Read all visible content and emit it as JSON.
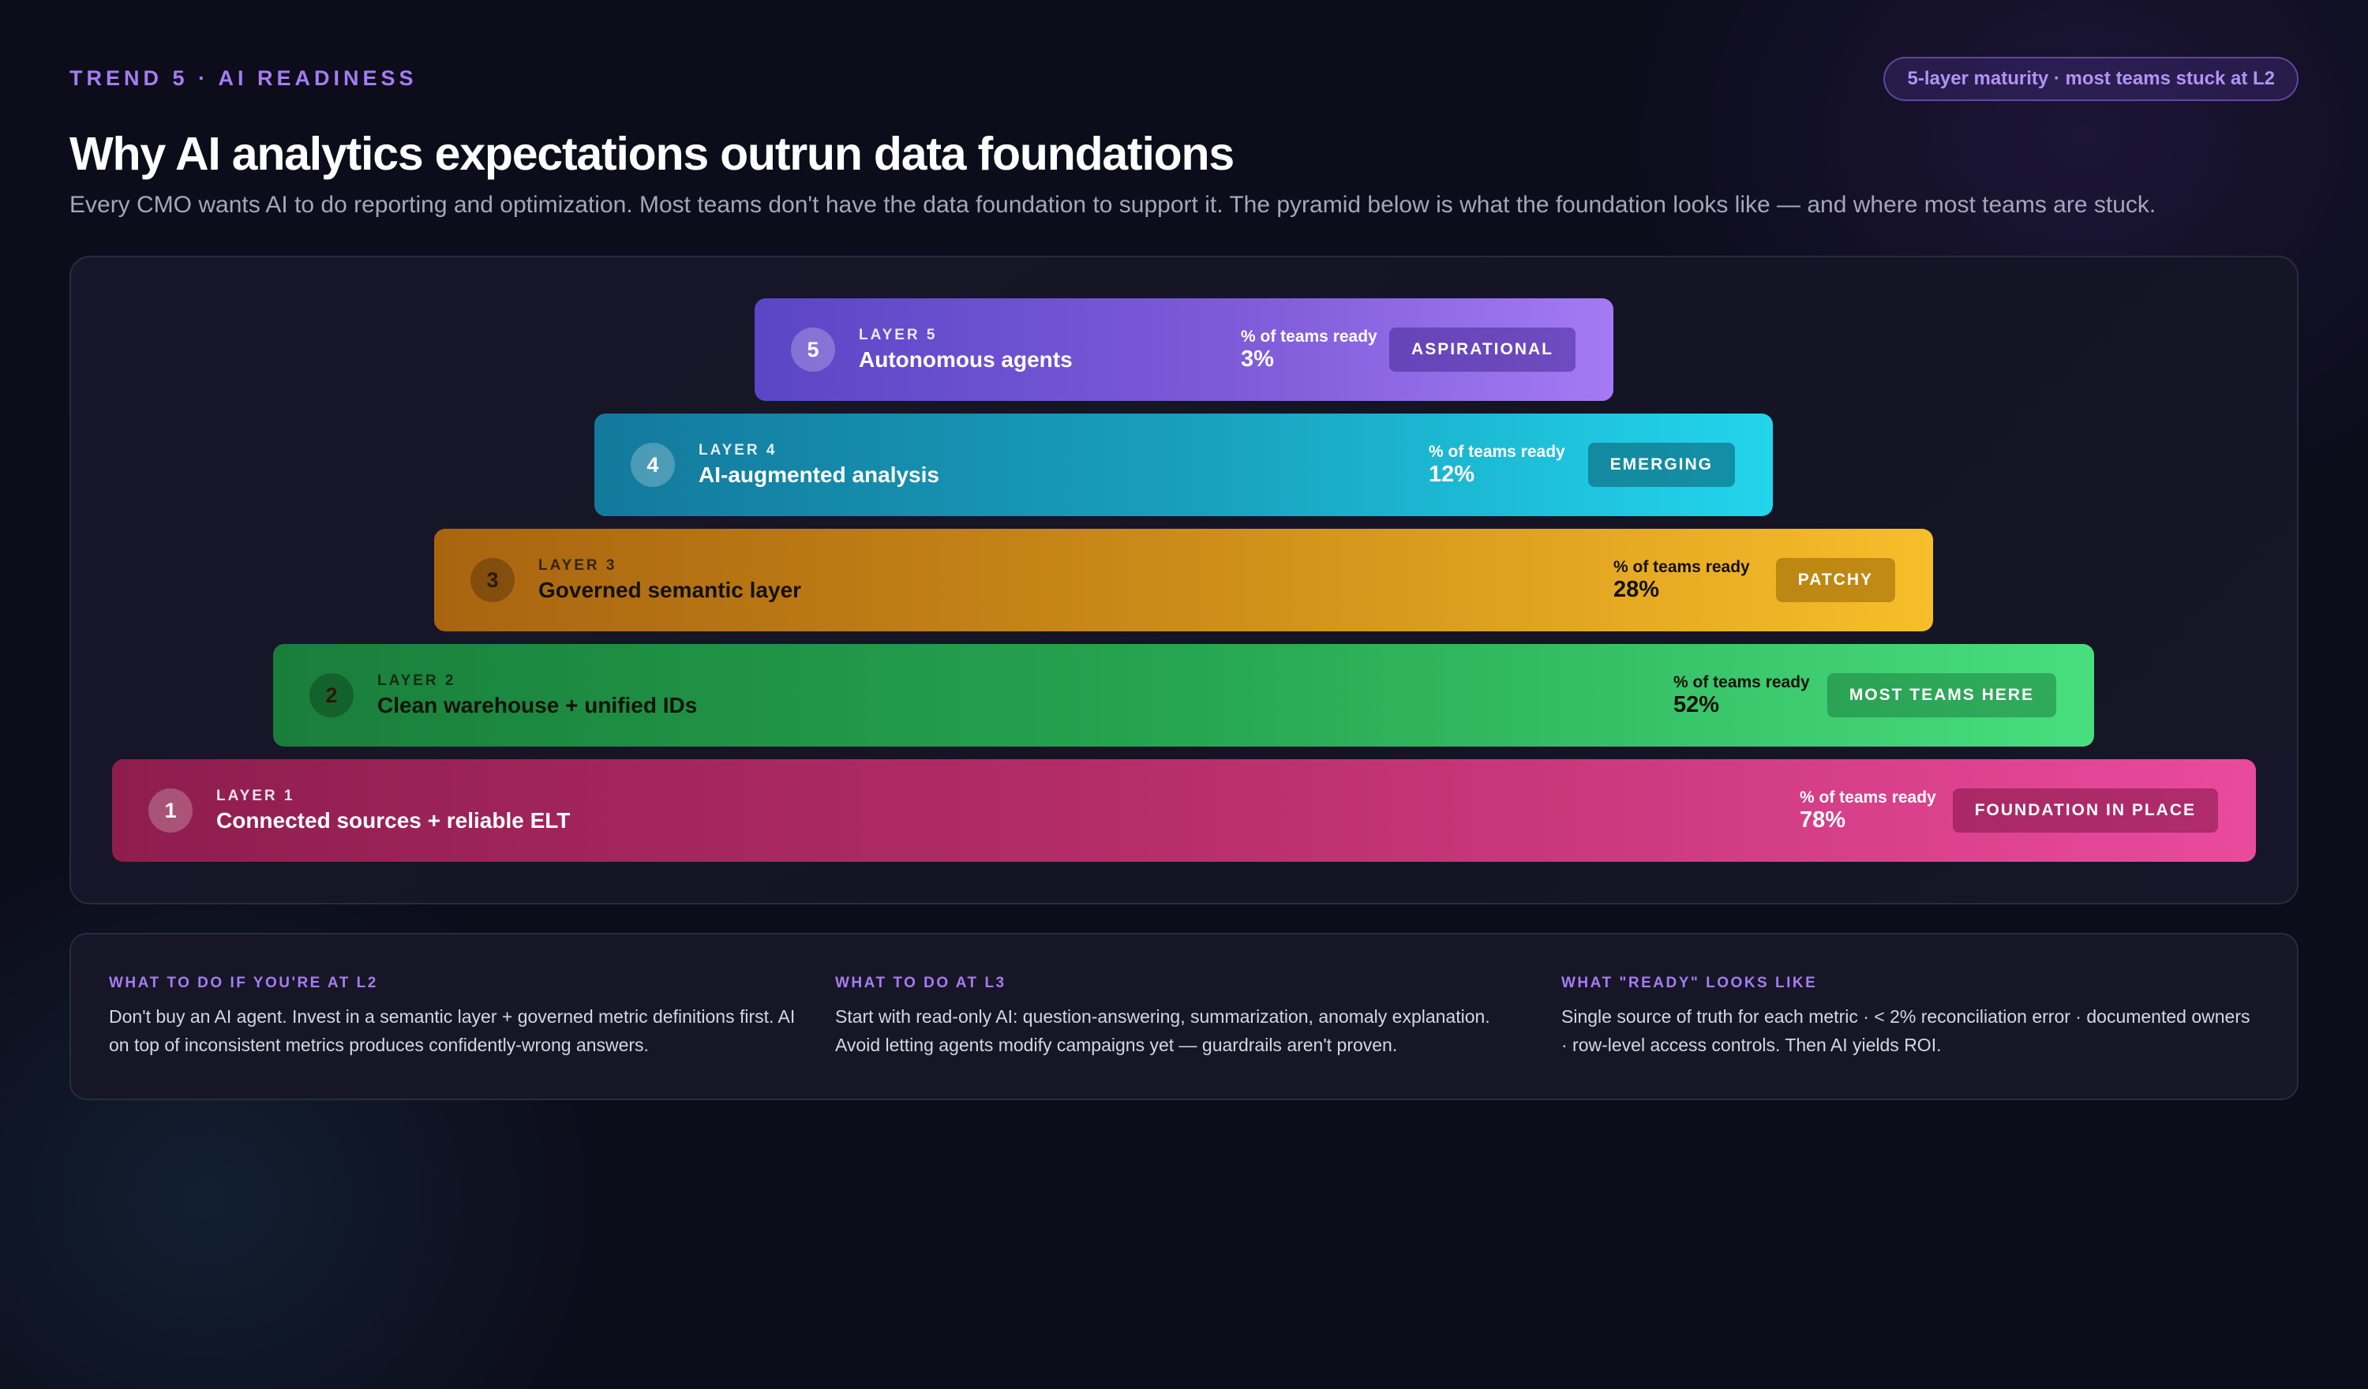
{
  "header": {
    "eyebrow": "TREND 5 · AI READINESS",
    "pill": "5-layer maturity · most teams stuck at L2",
    "title": "Why AI analytics expectations outrun data foundations",
    "subtitle": "Every CMO wants AI to do reporting and optimization. Most teams don't have the data foundation to support it. The pyramid below is what the foundation looks like — and where most teams are stuck."
  },
  "pyramid": {
    "ready_label": "% of teams ready",
    "layers": [
      {
        "number": "5",
        "kicker": "LAYER 5",
        "name": "Autonomous agents",
        "ready_pct": 3,
        "ready": "3%",
        "status": "ASPIRATIONAL",
        "color": "#7d5ad8"
      },
      {
        "number": "4",
        "kicker": "LAYER 4",
        "name": "AI-augmented analysis",
        "ready_pct": 12,
        "ready": "12%",
        "status": "EMERGING",
        "color": "#189fbd"
      },
      {
        "number": "3",
        "kicker": "LAYER 3",
        "name": "Governed semantic layer",
        "ready_pct": 28,
        "ready": "28%",
        "status": "PATCHY",
        "color": "#cc8c18"
      },
      {
        "number": "2",
        "kicker": "LAYER 2",
        "name": "Clean warehouse + unified IDs",
        "ready_pct": 52,
        "ready": "52%",
        "status": "MOST TEAMS HERE",
        "color": "#26a550"
      },
      {
        "number": "1",
        "kicker": "LAYER 1",
        "name": "Connected sources + reliable ELT",
        "ready_pct": 78,
        "ready": "78%",
        "status": "FOUNDATION IN PLACE",
        "color": "#b82e6a"
      }
    ]
  },
  "cards": [
    {
      "kicker": "WHAT TO DO IF YOU'RE AT L2",
      "body": "Don't buy an AI agent. Invest in a semantic layer + governed metric definitions first. AI on top of inconsistent metrics produces confidently-wrong answers."
    },
    {
      "kicker": "WHAT TO DO AT L3",
      "body": "Start with read-only AI: question-answering, summarization, anomaly explanation. Avoid letting agents modify campaigns yet — guardrails aren't proven."
    },
    {
      "kicker": "WHAT \"READY\" LOOKS LIKE",
      "body": "Single source of truth for each metric · < 2% reconciliation error · documented owners · row-level access controls. Then AI yields ROI."
    }
  ]
}
